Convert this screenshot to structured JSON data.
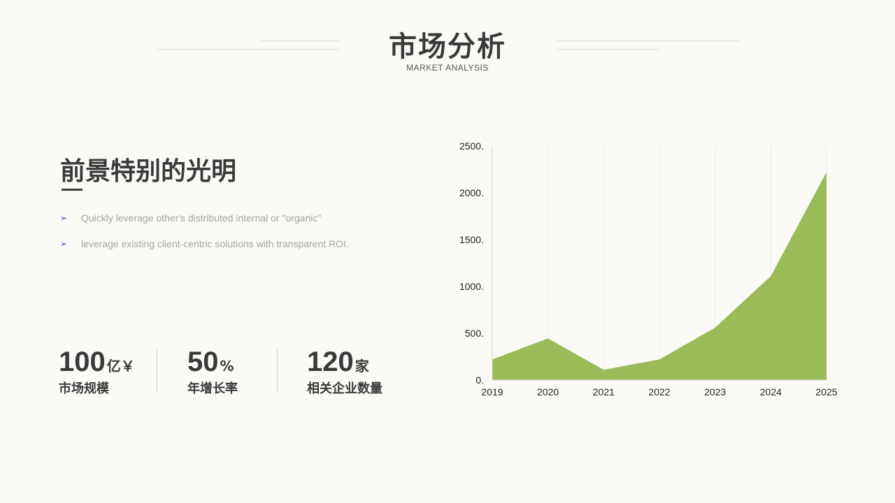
{
  "header": {
    "title": "市场分析",
    "subtitle": "MARKET ANALYSIS"
  },
  "section": {
    "heading": "前景特别的光明",
    "bullets": [
      {
        "icon": "arrow-bullet-icon",
        "text": "Quickly leverage other's distributed internal or \"organic\""
      },
      {
        "icon": "arrow-bullet-icon",
        "text": "leverage existing client-centric solutions with transparent ROI."
      }
    ]
  },
  "stats": [
    {
      "value": "100",
      "unit": "亿￥",
      "label": "市场规模"
    },
    {
      "value": "50",
      "unit": "%",
      "label": "年增长率"
    },
    {
      "value": "120",
      "unit": "家",
      "label": "相关企业数量"
    }
  ],
  "colors": {
    "area": "#9bbb59",
    "accent": "#2f4fb0",
    "text": "#3a3a3a"
  },
  "chart_data": {
    "type": "area",
    "x": [
      "2019",
      "2020",
      "2021",
      "2022",
      "2023",
      "2024",
      "2025"
    ],
    "series": [
      {
        "values": [
          220,
          445,
          110,
          220,
          560,
          1110,
          2220
        ]
      }
    ],
    "yticks": [
      "0.",
      "500.",
      "1000.",
      "1500.",
      "2000.",
      "2500."
    ],
    "ylim": [
      0,
      2500
    ],
    "grid": "vertical",
    "legend": "none"
  }
}
